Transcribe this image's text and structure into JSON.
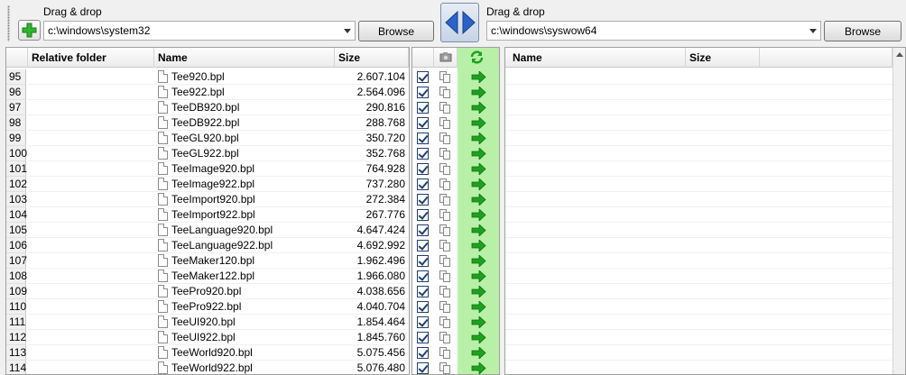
{
  "left_panel": {
    "label": "Drag & drop",
    "path": "c:\\windows\\system32",
    "browse_label": "Browse"
  },
  "right_panel": {
    "label": "Drag & drop",
    "path": "c:\\windows\\syswow64",
    "browse_label": "Browse"
  },
  "left_grid": {
    "headers": {
      "relative_folder": "Relative folder",
      "name": "Name",
      "size": "Size"
    },
    "rows": [
      {
        "num": "95",
        "name": "Tee920.bpl",
        "size": "2.607.104"
      },
      {
        "num": "96",
        "name": "Tee922.bpl",
        "size": "2.564.096"
      },
      {
        "num": "97",
        "name": "TeeDB920.bpl",
        "size": "290.816"
      },
      {
        "num": "98",
        "name": "TeeDB922.bpl",
        "size": "288.768"
      },
      {
        "num": "99",
        "name": "TeeGL920.bpl",
        "size": "350.720"
      },
      {
        "num": "100",
        "name": "TeeGL922.bpl",
        "size": "352.768"
      },
      {
        "num": "101",
        "name": "TeeImage920.bpl",
        "size": "764.928"
      },
      {
        "num": "102",
        "name": "TeeImage922.bpl",
        "size": "737.280"
      },
      {
        "num": "103",
        "name": "TeeImport920.bpl",
        "size": "272.384"
      },
      {
        "num": "104",
        "name": "TeeImport922.bpl",
        "size": "267.776"
      },
      {
        "num": "105",
        "name": "TeeLanguage920.bpl",
        "size": "4.647.424"
      },
      {
        "num": "106",
        "name": "TeeLanguage922.bpl",
        "size": "4.692.992"
      },
      {
        "num": "107",
        "name": "TeeMaker120.bpl",
        "size": "1.962.496"
      },
      {
        "num": "108",
        "name": "TeeMaker122.bpl",
        "size": "1.966.080"
      },
      {
        "num": "109",
        "name": "TeePro920.bpl",
        "size": "4.038.656"
      },
      {
        "num": "110",
        "name": "TeePro922.bpl",
        "size": "4.040.704"
      },
      {
        "num": "111",
        "name": "TeeUI920.bpl",
        "size": "1.854.464"
      },
      {
        "num": "112",
        "name": "TeeUI922.bpl",
        "size": "1.845.760"
      },
      {
        "num": "113",
        "name": "TeeWorld920.bpl",
        "size": "5.075.456"
      },
      {
        "num": "114",
        "name": "TeeWorld922.bpl",
        "size": "5.076.480"
      }
    ]
  },
  "right_grid": {
    "headers": {
      "name": "Name",
      "size": "Size"
    }
  },
  "icons": {
    "add": "green-plus-icon",
    "swap": "swap-arrows-icon",
    "camera": "camera-icon",
    "refresh": "refresh-icon",
    "copy": "copy-icon",
    "action": "green-arrow-icon"
  },
  "colors": {
    "action_column": "#b8f0a8",
    "swap_accent": "#2b63c8",
    "green_icon": "#1fa11f"
  }
}
